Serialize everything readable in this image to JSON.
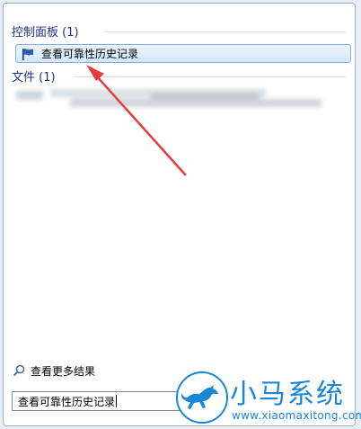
{
  "groups": [
    {
      "title": "控制面板 (1)"
    },
    {
      "title": "文件 (1)"
    }
  ],
  "control_panel_item": {
    "label": "查看可靠性历史记录",
    "icon": "flag-icon"
  },
  "see_more": {
    "label": "查看更多结果",
    "icon": "search-icon"
  },
  "search": {
    "value": "查看可靠性历史记录"
  },
  "watermark": {
    "brand": "小马系统",
    "url": "www.xiaomaxitong.com"
  },
  "colors": {
    "accent": "#1e3287",
    "arrow": "#e83b3b",
    "brand": "#1a86d6"
  }
}
